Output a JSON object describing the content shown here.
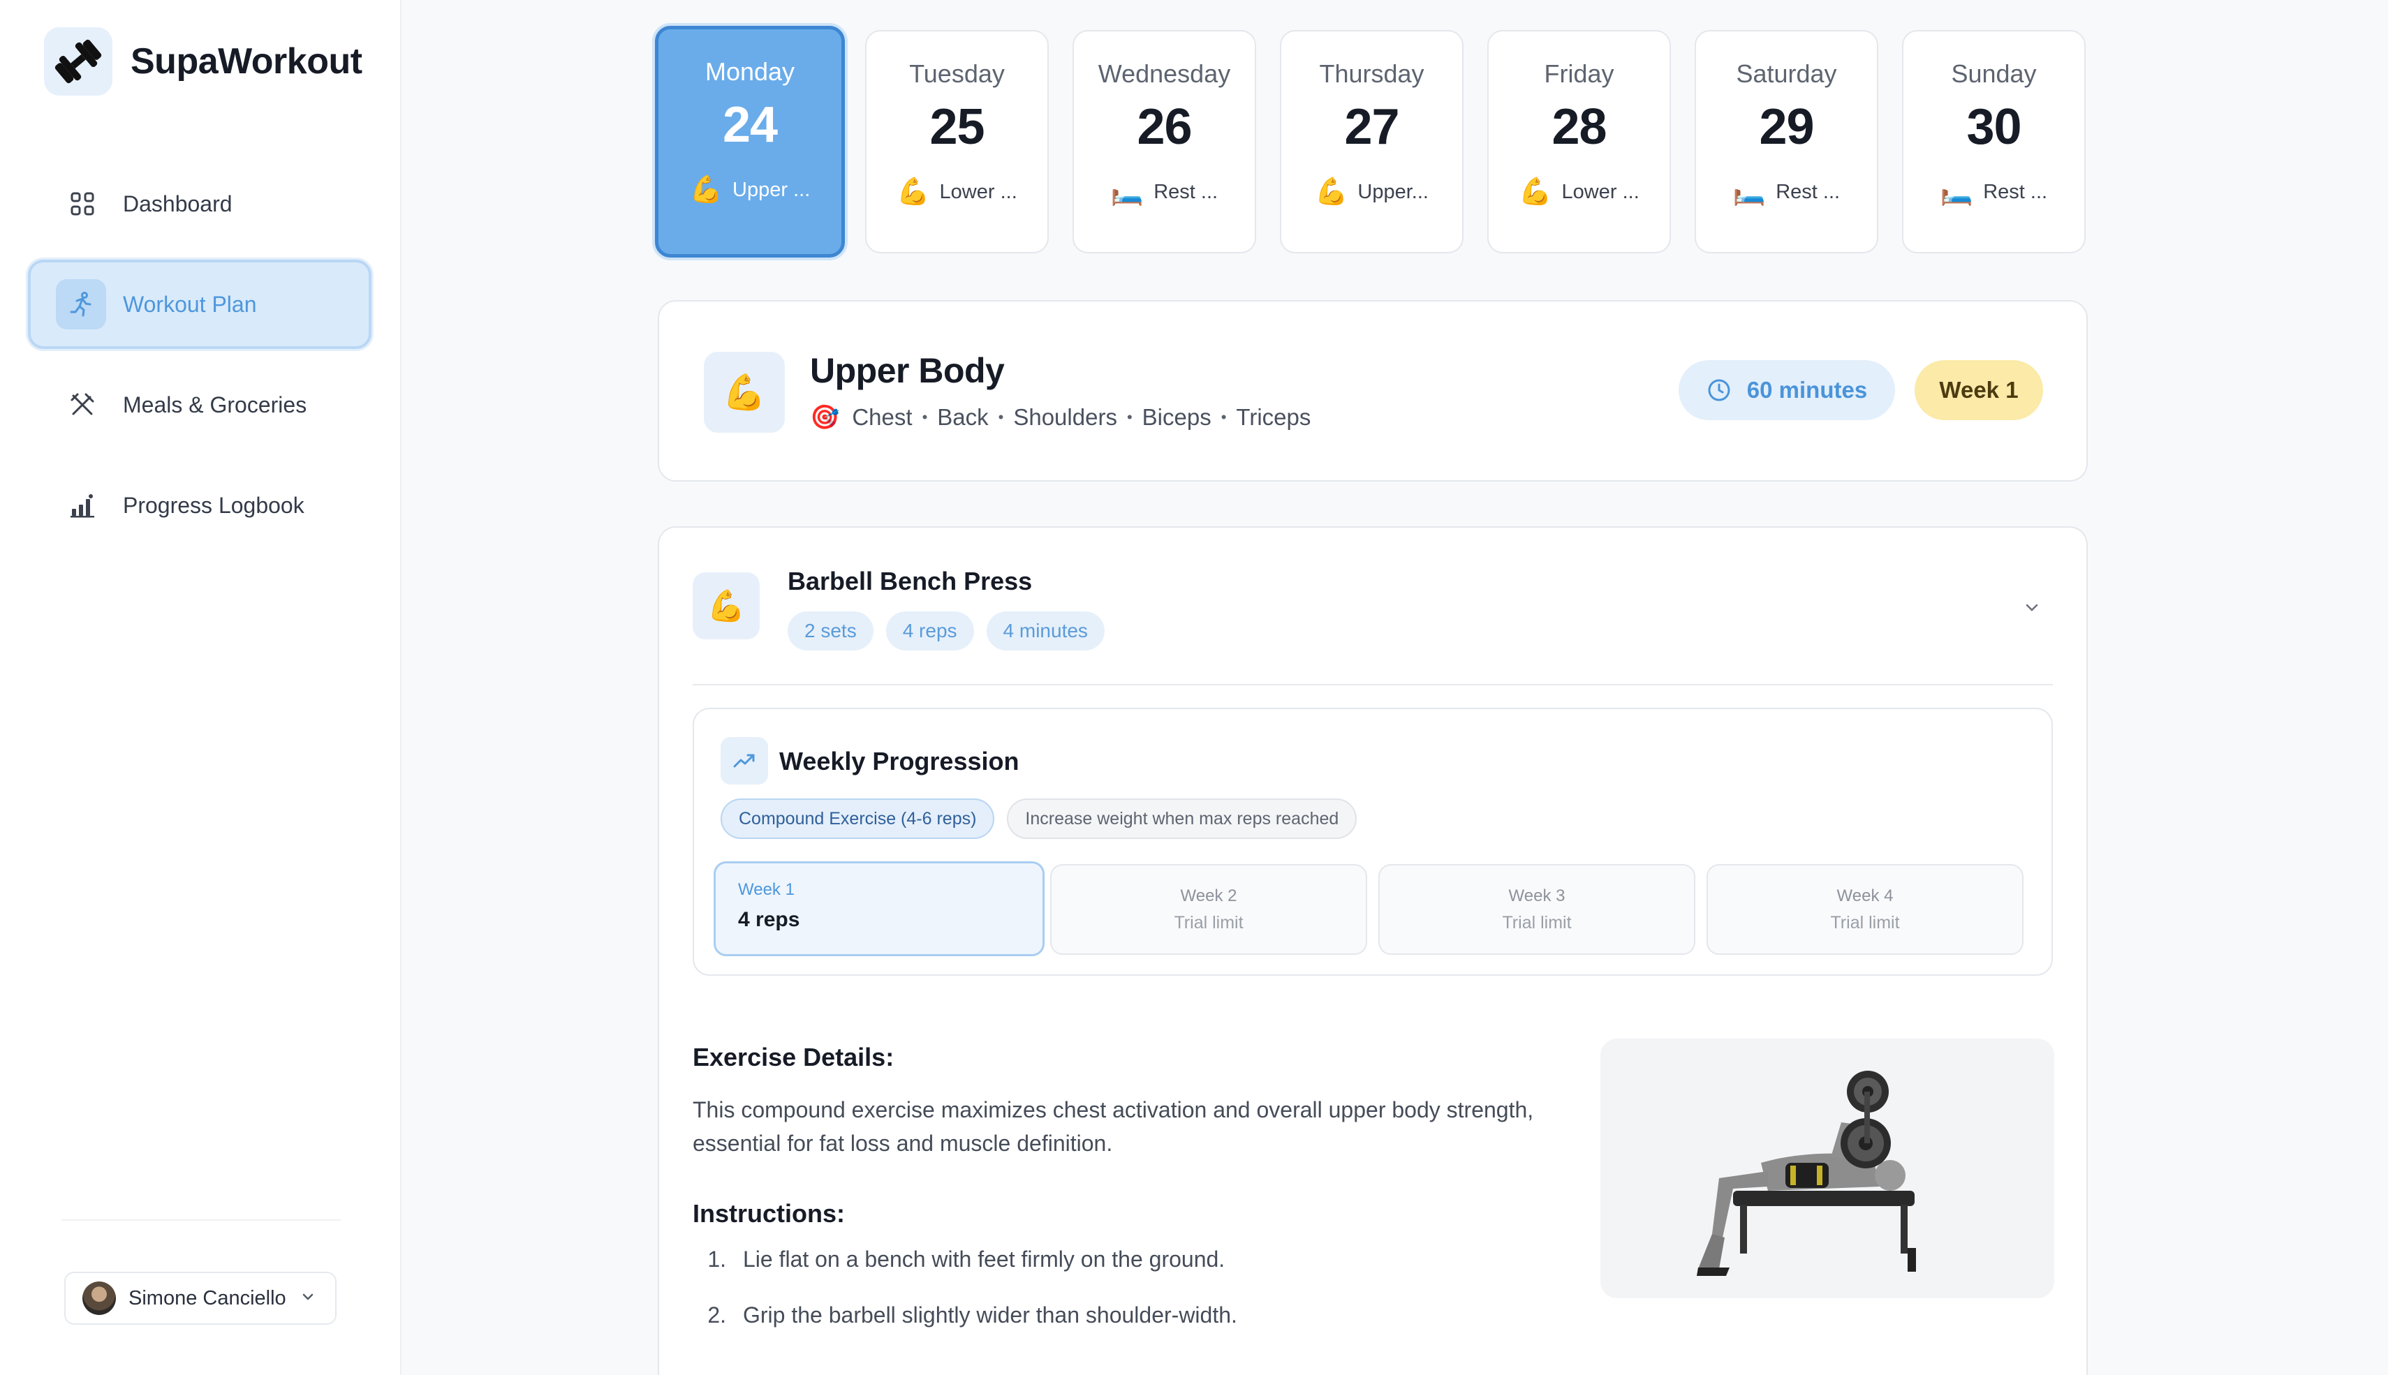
{
  "app": {
    "name": "SupaWorkout"
  },
  "sidebar": {
    "items": [
      {
        "label": "Dashboard",
        "icon": "grid-icon",
        "active": false
      },
      {
        "label": "Workout Plan",
        "icon": "running-person-icon",
        "active": true
      },
      {
        "label": "Meals & Groceries",
        "icon": "utensils-icon",
        "active": false
      },
      {
        "label": "Progress Logbook",
        "icon": "bar-chart-icon",
        "active": false
      }
    ],
    "user": {
      "name": "Simone Canciello"
    }
  },
  "days": [
    {
      "name": "Monday",
      "num": "24",
      "emoji": "💪",
      "label": "Upper ...",
      "active": true
    },
    {
      "name": "Tuesday",
      "num": "25",
      "emoji": "💪",
      "label": "Lower ...",
      "active": false
    },
    {
      "name": "Wednesday",
      "num": "26",
      "emoji": "🛏️",
      "label": "Rest ...",
      "active": false
    },
    {
      "name": "Thursday",
      "num": "27",
      "emoji": "💪",
      "label": "Upper...",
      "active": false
    },
    {
      "name": "Friday",
      "num": "28",
      "emoji": "💪",
      "label": "Lower ...",
      "active": false
    },
    {
      "name": "Saturday",
      "num": "29",
      "emoji": "🛏️",
      "label": "Rest ...",
      "active": false
    },
    {
      "name": "Sunday",
      "num": "30",
      "emoji": "🛏️",
      "label": "Rest ...",
      "active": false
    }
  ],
  "workout": {
    "emoji": "💪",
    "title": "Upper Body",
    "target_emoji": "🎯",
    "muscles": [
      "Chest",
      "Back",
      "Shoulders",
      "Biceps",
      "Triceps"
    ],
    "separator": "•",
    "duration": "60 minutes",
    "week": "Week 1"
  },
  "exercise": {
    "emoji": "💪",
    "title": "Barbell Bench Press",
    "chips": [
      "2 sets",
      "4 reps",
      "4 minutes"
    ],
    "progression": {
      "title": "Weekly Progression",
      "tag_primary": "Compound Exercise (4-6 reps)",
      "tag_secondary": "Increase weight when max reps reached",
      "weeks": [
        {
          "label": "Week 1",
          "sub": "4 reps",
          "active": true
        },
        {
          "label": "Week 2",
          "sub": "Trial limit",
          "active": false
        },
        {
          "label": "Week 3",
          "sub": "Trial limit",
          "active": false
        },
        {
          "label": "Week 4",
          "sub": "Trial limit",
          "active": false
        }
      ]
    },
    "details_heading": "Exercise Details:",
    "details_text": "This compound exercise maximizes chest activation and overall upper body strength, essential for fat loss and muscle definition.",
    "instructions_heading": "Instructions:",
    "instructions": [
      {
        "n": "1.",
        "text": "Lie flat on a bench with feet firmly on the ground."
      },
      {
        "n": "2.",
        "text": "Grip the barbell slightly wider than shoulder-width."
      }
    ]
  },
  "colors": {
    "accent": "#4e97dc",
    "accent_bg": "#d9eafa",
    "week_pill": "#fbeaa8"
  }
}
